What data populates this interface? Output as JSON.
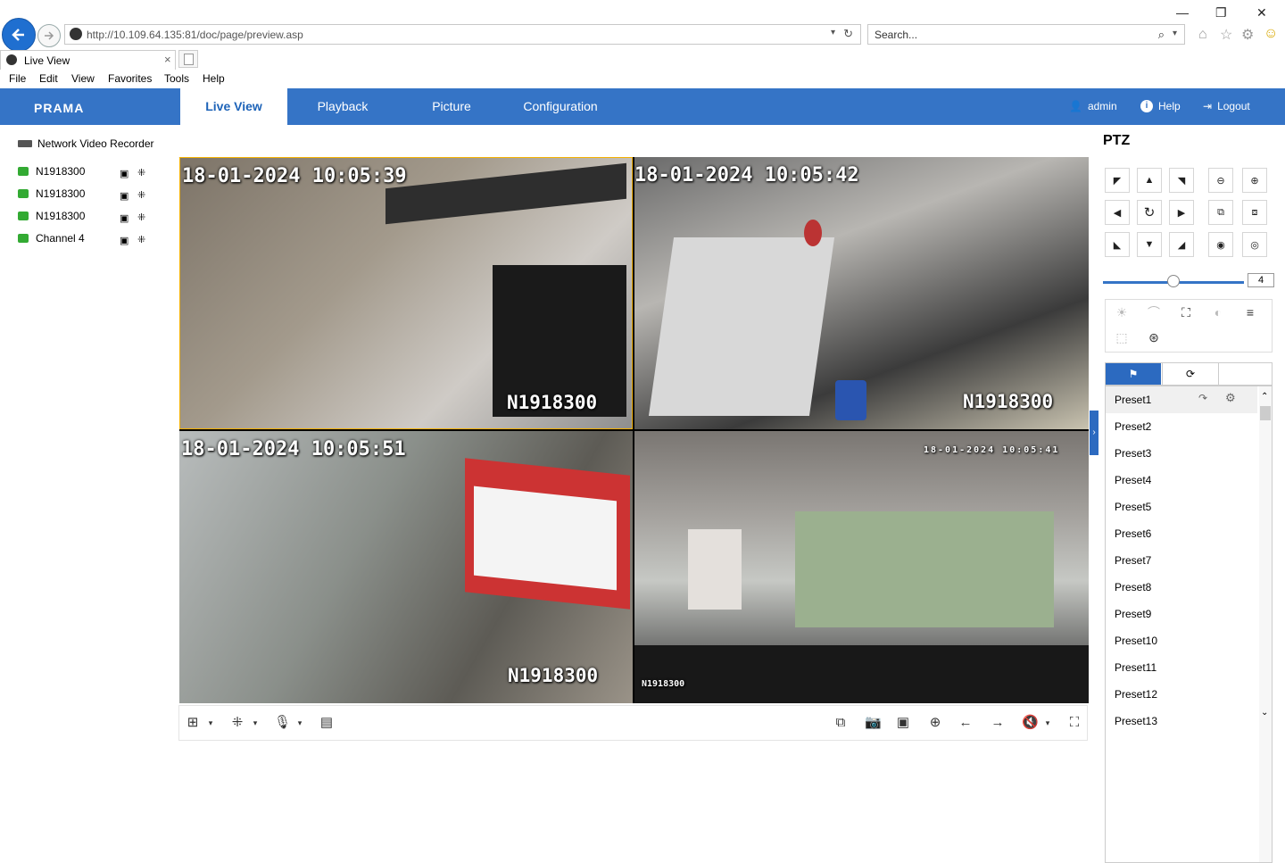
{
  "browser": {
    "url": "http://10.109.64.135:81/doc/page/preview.asp",
    "search_placeholder": "Search...",
    "tab_title": "Live View",
    "menu": [
      "File",
      "Edit",
      "View",
      "Favorites",
      "Tools",
      "Help"
    ],
    "window_controls": [
      "—",
      "❐",
      "✕"
    ]
  },
  "app": {
    "logo": "PRAMA",
    "nav": [
      "Live View",
      "Playback",
      "Picture",
      "Configuration"
    ],
    "active_nav": "Live View",
    "user": "admin",
    "help": "Help",
    "logout": "Logout"
  },
  "tree": {
    "root": "Network Video Recorder",
    "channels": [
      "N1918300",
      "N1918300",
      "N1918300",
      "Channel 4"
    ]
  },
  "cameras": [
    {
      "timestamp": "18-01-2024 10:05:39",
      "name": "N1918300",
      "selected": true
    },
    {
      "timestamp": "18-01-2024 10:05:42",
      "name": "N1918300",
      "selected": false
    },
    {
      "timestamp": "18-01-2024 10:05:51",
      "name": "N1918300",
      "selected": false
    },
    {
      "timestamp": "18-01-2024 10:05:41",
      "name": "N1918300",
      "selected": false
    }
  ],
  "ptz": {
    "title": "PTZ",
    "speed": "4",
    "speed_level": 0.5,
    "presets": [
      "Preset1",
      "Preset2",
      "Preset3",
      "Preset4",
      "Preset5",
      "Preset6",
      "Preset7",
      "Preset8",
      "Preset9",
      "Preset10",
      "Preset11",
      "Preset12",
      "Preset13"
    ]
  },
  "colors": {
    "accent": "#3574c6",
    "selected_border": "#f3b000"
  }
}
